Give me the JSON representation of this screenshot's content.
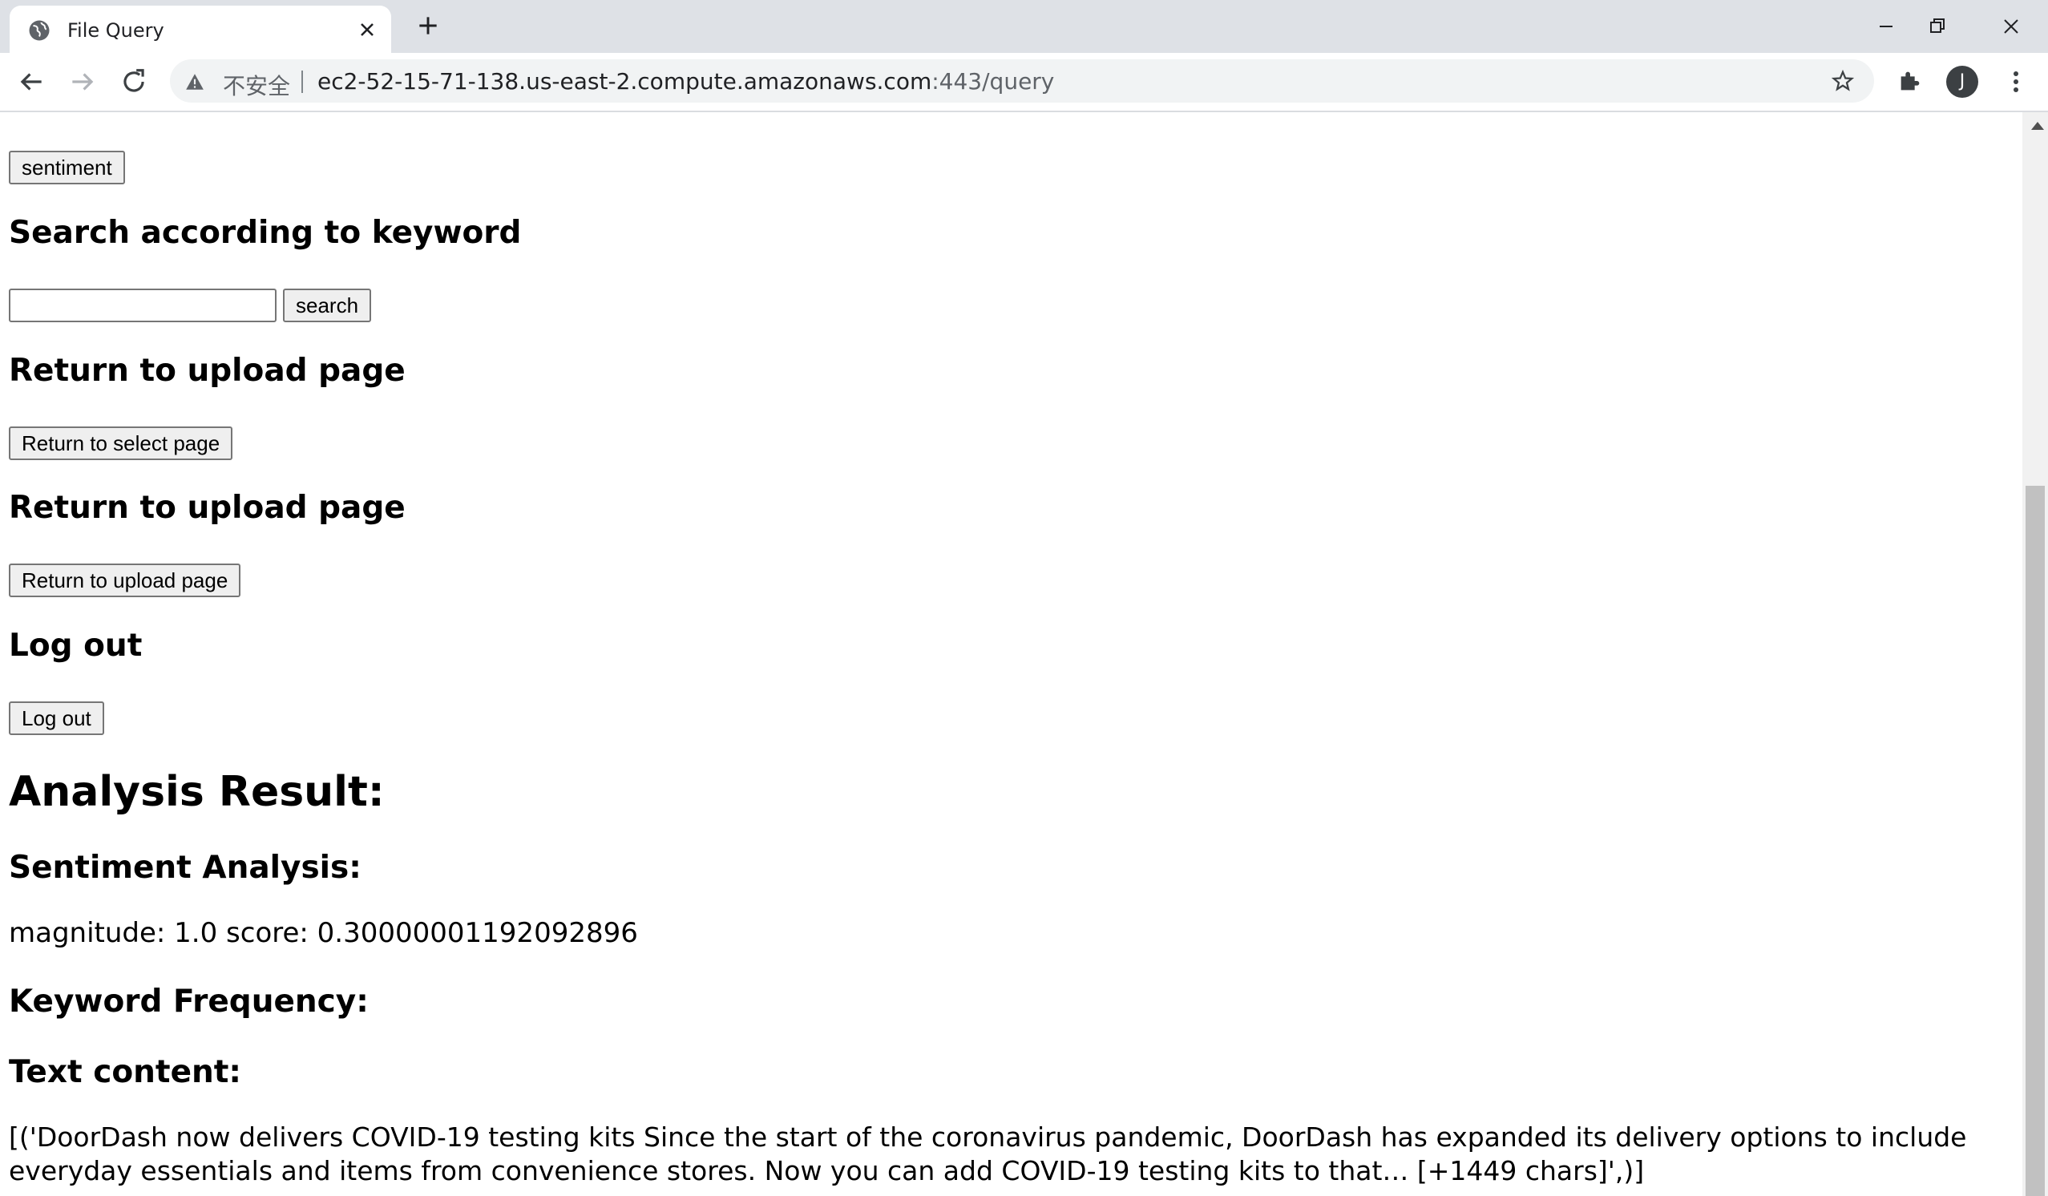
{
  "browser": {
    "tab_title": "File Query",
    "insecure_label": "不安全",
    "url_host": "ec2-52-15-71-138.us-east-2.compute.amazonaws.com",
    "url_rest": ":443/query",
    "avatar_initial": "J"
  },
  "page": {
    "sentiment_button": "sentiment",
    "search_heading": "Search according to keyword",
    "search_input_value": "",
    "search_button": "search",
    "return_heading_1": "Return to upload page",
    "return_select_button": "Return to select page",
    "return_heading_2": "Return to upload page",
    "return_upload_button": "Return to upload page",
    "logout_heading": "Log out",
    "logout_button": "Log out",
    "result_heading": "Analysis Result:",
    "sentiment_heading": "Sentiment Analysis:",
    "sentiment_text": "magnitude: 1.0 score: 0.30000001192092896",
    "keyword_heading": "Keyword Frequency:",
    "text_content_heading": "Text content:",
    "text_content": "[('DoorDash now delivers COVID-19 testing kits Since the start of the coronavirus pandemic, DoorDash has expanded its delivery options to include everyday essentials and items from convenience stores. Now you can add COVID-19 testing kits to that… [+1449 chars]',)]"
  },
  "icons": [
    "globe-icon",
    "close-icon",
    "plus-icon",
    "minimize-icon",
    "restore-icon",
    "window-close-icon",
    "back-arrow-icon",
    "forward-arrow-icon",
    "reload-icon",
    "warning-icon",
    "star-icon",
    "extensions-icon",
    "kebab-menu-icon",
    "scroll-up-arrow-icon"
  ]
}
